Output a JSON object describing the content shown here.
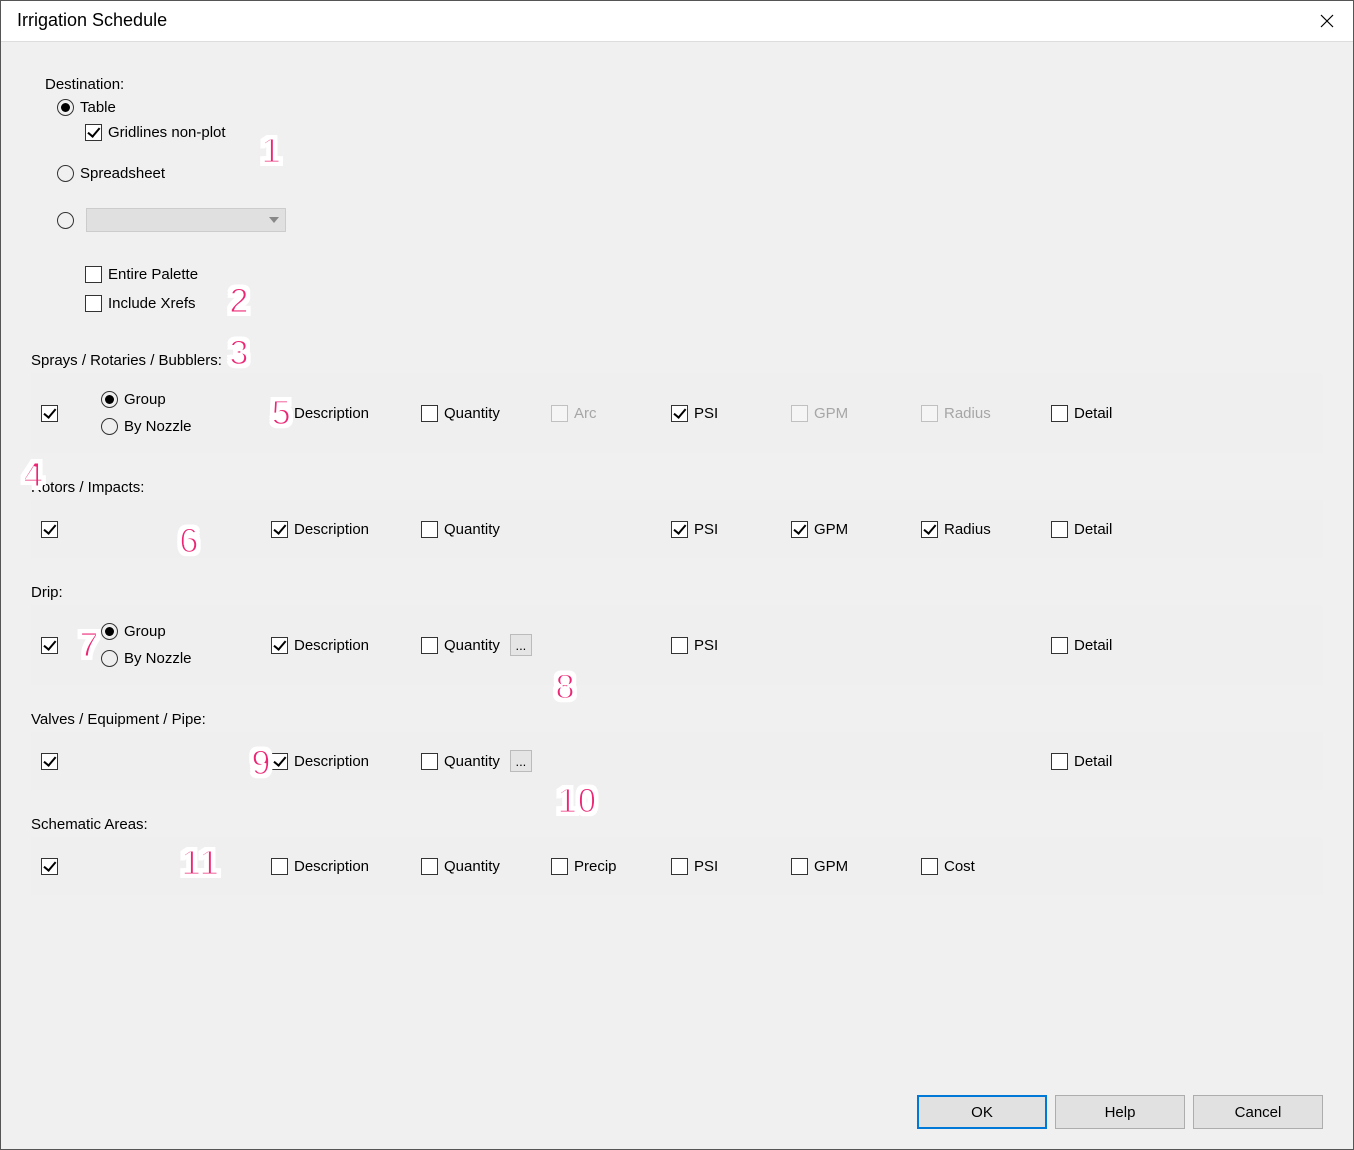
{
  "window": {
    "title": "Irrigation Schedule"
  },
  "destination": {
    "label": "Destination:",
    "table": "Table",
    "gridlines": "Gridlines non-plot",
    "spreadsheet": "Spreadsheet",
    "entire_palette": "Entire Palette",
    "include_xrefs": "Include Xrefs"
  },
  "common": {
    "group": "Group",
    "by_nozzle": "By Nozzle",
    "description": "Description",
    "quantity": "Quantity",
    "arc": "Arc",
    "psi": "PSI",
    "gpm": "GPM",
    "radius": "Radius",
    "detail": "Detail",
    "precip": "Precip",
    "cost": "Cost",
    "ellipsis": "..."
  },
  "sections": {
    "sprays": {
      "title": "Sprays / Rotaries / Bubblers:"
    },
    "rotors": {
      "title": "Rotors / Impacts:"
    },
    "drip": {
      "title": "Drip:"
    },
    "valves": {
      "title": "Valves / Equipment / Pipe:"
    },
    "schem": {
      "title": "Schematic Areas:"
    }
  },
  "buttons": {
    "ok": "OK",
    "help": "Help",
    "cancel": "Cancel"
  },
  "annotations": {
    "1": "1",
    "2": "2",
    "3": "3",
    "4": "4",
    "5": "5",
    "6": "6",
    "7": "7",
    "8": "8",
    "9": "9",
    "10": "10",
    "11": "11"
  }
}
